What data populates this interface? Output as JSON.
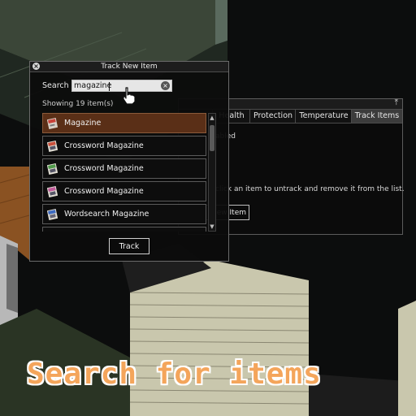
{
  "dialog": {
    "title": "Track New Item",
    "search_label": "Search",
    "search_value": "magazine",
    "showing_text": "Showing 19 item(s)",
    "items": [
      {
        "label": "Magazine",
        "selected": true,
        "icon": "magazine-icon"
      },
      {
        "label": "Crossword Magazine",
        "selected": false,
        "icon": "crossword-magazine-icon"
      },
      {
        "label": "Crossword Magazine",
        "selected": false,
        "icon": "crossword-magazine-icon"
      },
      {
        "label": "Crossword Magazine",
        "selected": false,
        "icon": "crossword-magazine-icon"
      },
      {
        "label": "Wordsearch Magazine",
        "selected": false,
        "icon": "wordsearch-magazine-icon"
      }
    ],
    "track_button": "Track"
  },
  "back_panel": {
    "tabs": [
      "Health",
      "Protection",
      "Temperature",
      "Track Items"
    ],
    "active_tab": "Track Items",
    "status_text": "abled",
    "info_text": "click an item to untrack and remove it from the list.",
    "button_label": "New Item"
  },
  "caption": "Search for items",
  "colors": {
    "accent_caption": "#f4a55b",
    "selected_row": "#5a2f17"
  }
}
